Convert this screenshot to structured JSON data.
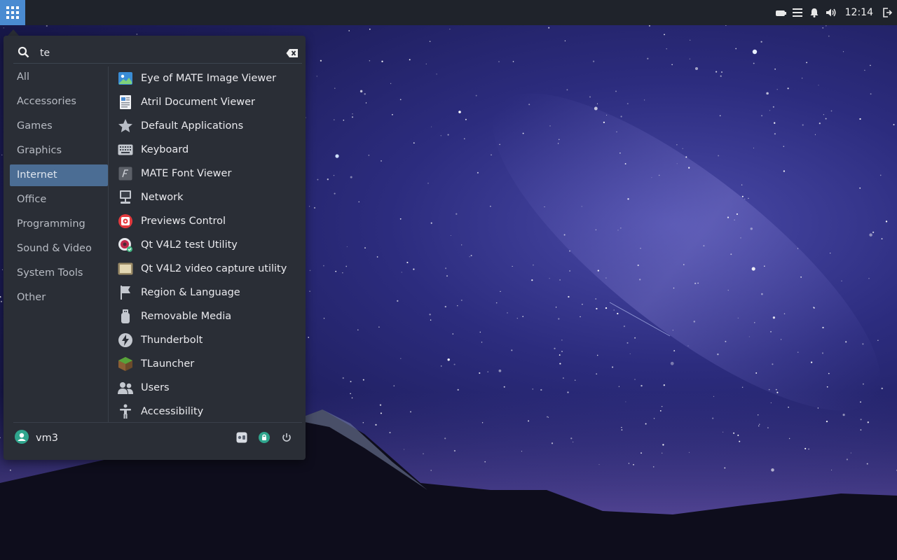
{
  "panel": {
    "menu_icon": "app-grid-icon",
    "tray_icons": [
      "battery-icon",
      "list-icon",
      "bell-icon",
      "volume-icon"
    ],
    "clock": "12:14",
    "logout_icon": "logout-icon"
  },
  "search": {
    "value": "te",
    "icon": "search-icon",
    "clear_icon": "backspace-clear-icon"
  },
  "categories": [
    {
      "label": "All"
    },
    {
      "label": "Accessories"
    },
    {
      "label": "Games"
    },
    {
      "label": "Graphics"
    },
    {
      "label": "Internet",
      "selected": true
    },
    {
      "label": "Office"
    },
    {
      "label": "Programming"
    },
    {
      "label": "Sound & Video"
    },
    {
      "label": "System Tools"
    },
    {
      "label": "Other"
    }
  ],
  "apps": [
    {
      "label": "Eye of MATE Image Viewer",
      "icon": "image-viewer-icon"
    },
    {
      "label": "Atril Document Viewer",
      "icon": "document-viewer-icon"
    },
    {
      "label": "Default Applications",
      "icon": "star-icon"
    },
    {
      "label": "Keyboard",
      "icon": "keyboard-icon"
    },
    {
      "label": "MATE Font Viewer",
      "icon": "font-viewer-icon"
    },
    {
      "label": "Network",
      "icon": "network-icon"
    },
    {
      "label": "Previews Control",
      "icon": "previews-control-icon"
    },
    {
      "label": "Qt V4L2 test Utility",
      "icon": "webcam-test-icon"
    },
    {
      "label": "Qt V4L2 video capture utility",
      "icon": "video-capture-icon"
    },
    {
      "label": "Region & Language",
      "icon": "flag-icon"
    },
    {
      "label": "Removable Media",
      "icon": "usb-drive-icon"
    },
    {
      "label": "Thunderbolt",
      "icon": "thunderbolt-icon"
    },
    {
      "label": "TLauncher",
      "icon": "tlauncher-icon"
    },
    {
      "label": "Users",
      "icon": "users-icon"
    },
    {
      "label": "Accessibility",
      "icon": "accessibility-icon"
    }
  ],
  "user": {
    "name": "vm3",
    "icon": "user-avatar-icon"
  },
  "actions": [
    "settings-panel-icon",
    "lock-screen-icon",
    "power-icon"
  ],
  "colors": {
    "panel": "#1f232b",
    "menu_bg": "#2a2e36",
    "accent": "#4a8bd1",
    "selected_category": "#4b6d94"
  }
}
